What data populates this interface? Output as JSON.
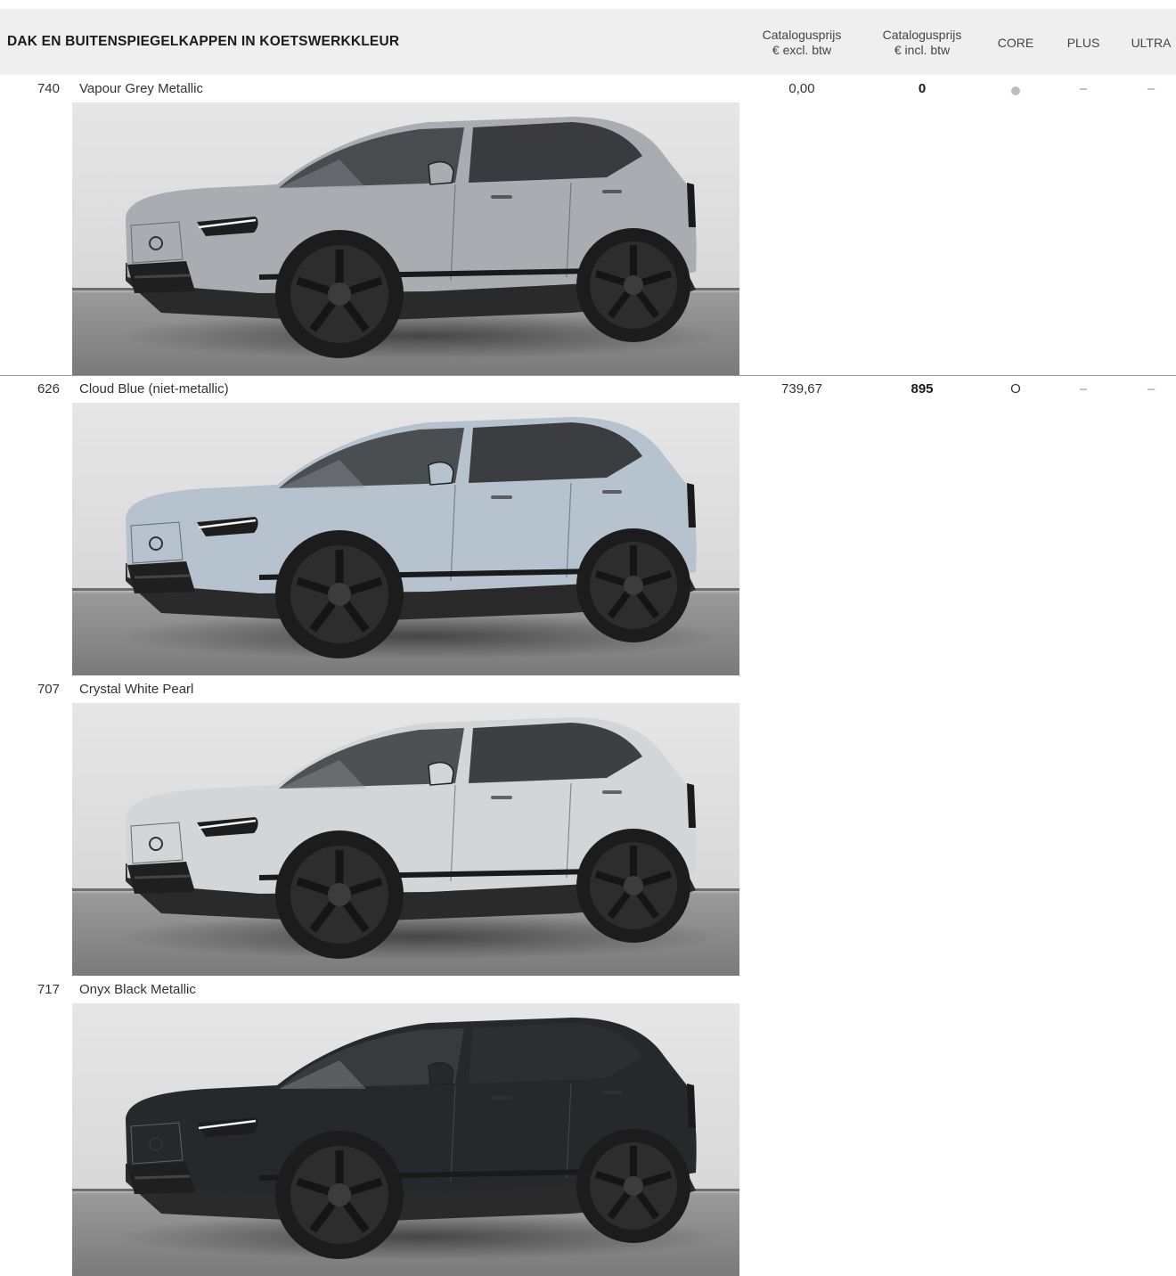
{
  "header": {
    "title": "DAK EN BUITENSPIEGELKAPPEN IN KOETSWERKKLEUR",
    "col_excl_line1": "Catalogusprijs",
    "col_excl_line2": "€ excl. btw",
    "col_incl_line1": "Catalogusprijs",
    "col_incl_line2": "€ incl. btw",
    "col_core": "CORE",
    "col_plus": "PLUS",
    "col_ultra": "ULTRA"
  },
  "rows": [
    {
      "code": "740",
      "name": "Vapour Grey Metallic",
      "price_excl": "0,00",
      "price_incl": "0",
      "core": "standard-dot",
      "plus": "–",
      "ultra": "–",
      "body_color": "#a9adb1"
    },
    {
      "code": "626",
      "name": "Cloud Blue (niet-metallic)",
      "price_excl": "739,67",
      "price_incl": "895",
      "core": "O",
      "plus": "–",
      "ultra": "–",
      "body_color": "#b6c2cd"
    },
    {
      "code": "707",
      "name": "Crystal White Pearl",
      "price_excl": "",
      "price_incl": "",
      "core": "",
      "plus": "",
      "ultra": "",
      "body_color": "#d4d5d6"
    },
    {
      "code": "717",
      "name": "Onyx Black Metallic",
      "price_excl": "",
      "price_incl": "",
      "core": "",
      "plus": "",
      "ultra": "",
      "body_color": "#26282b"
    }
  ]
}
